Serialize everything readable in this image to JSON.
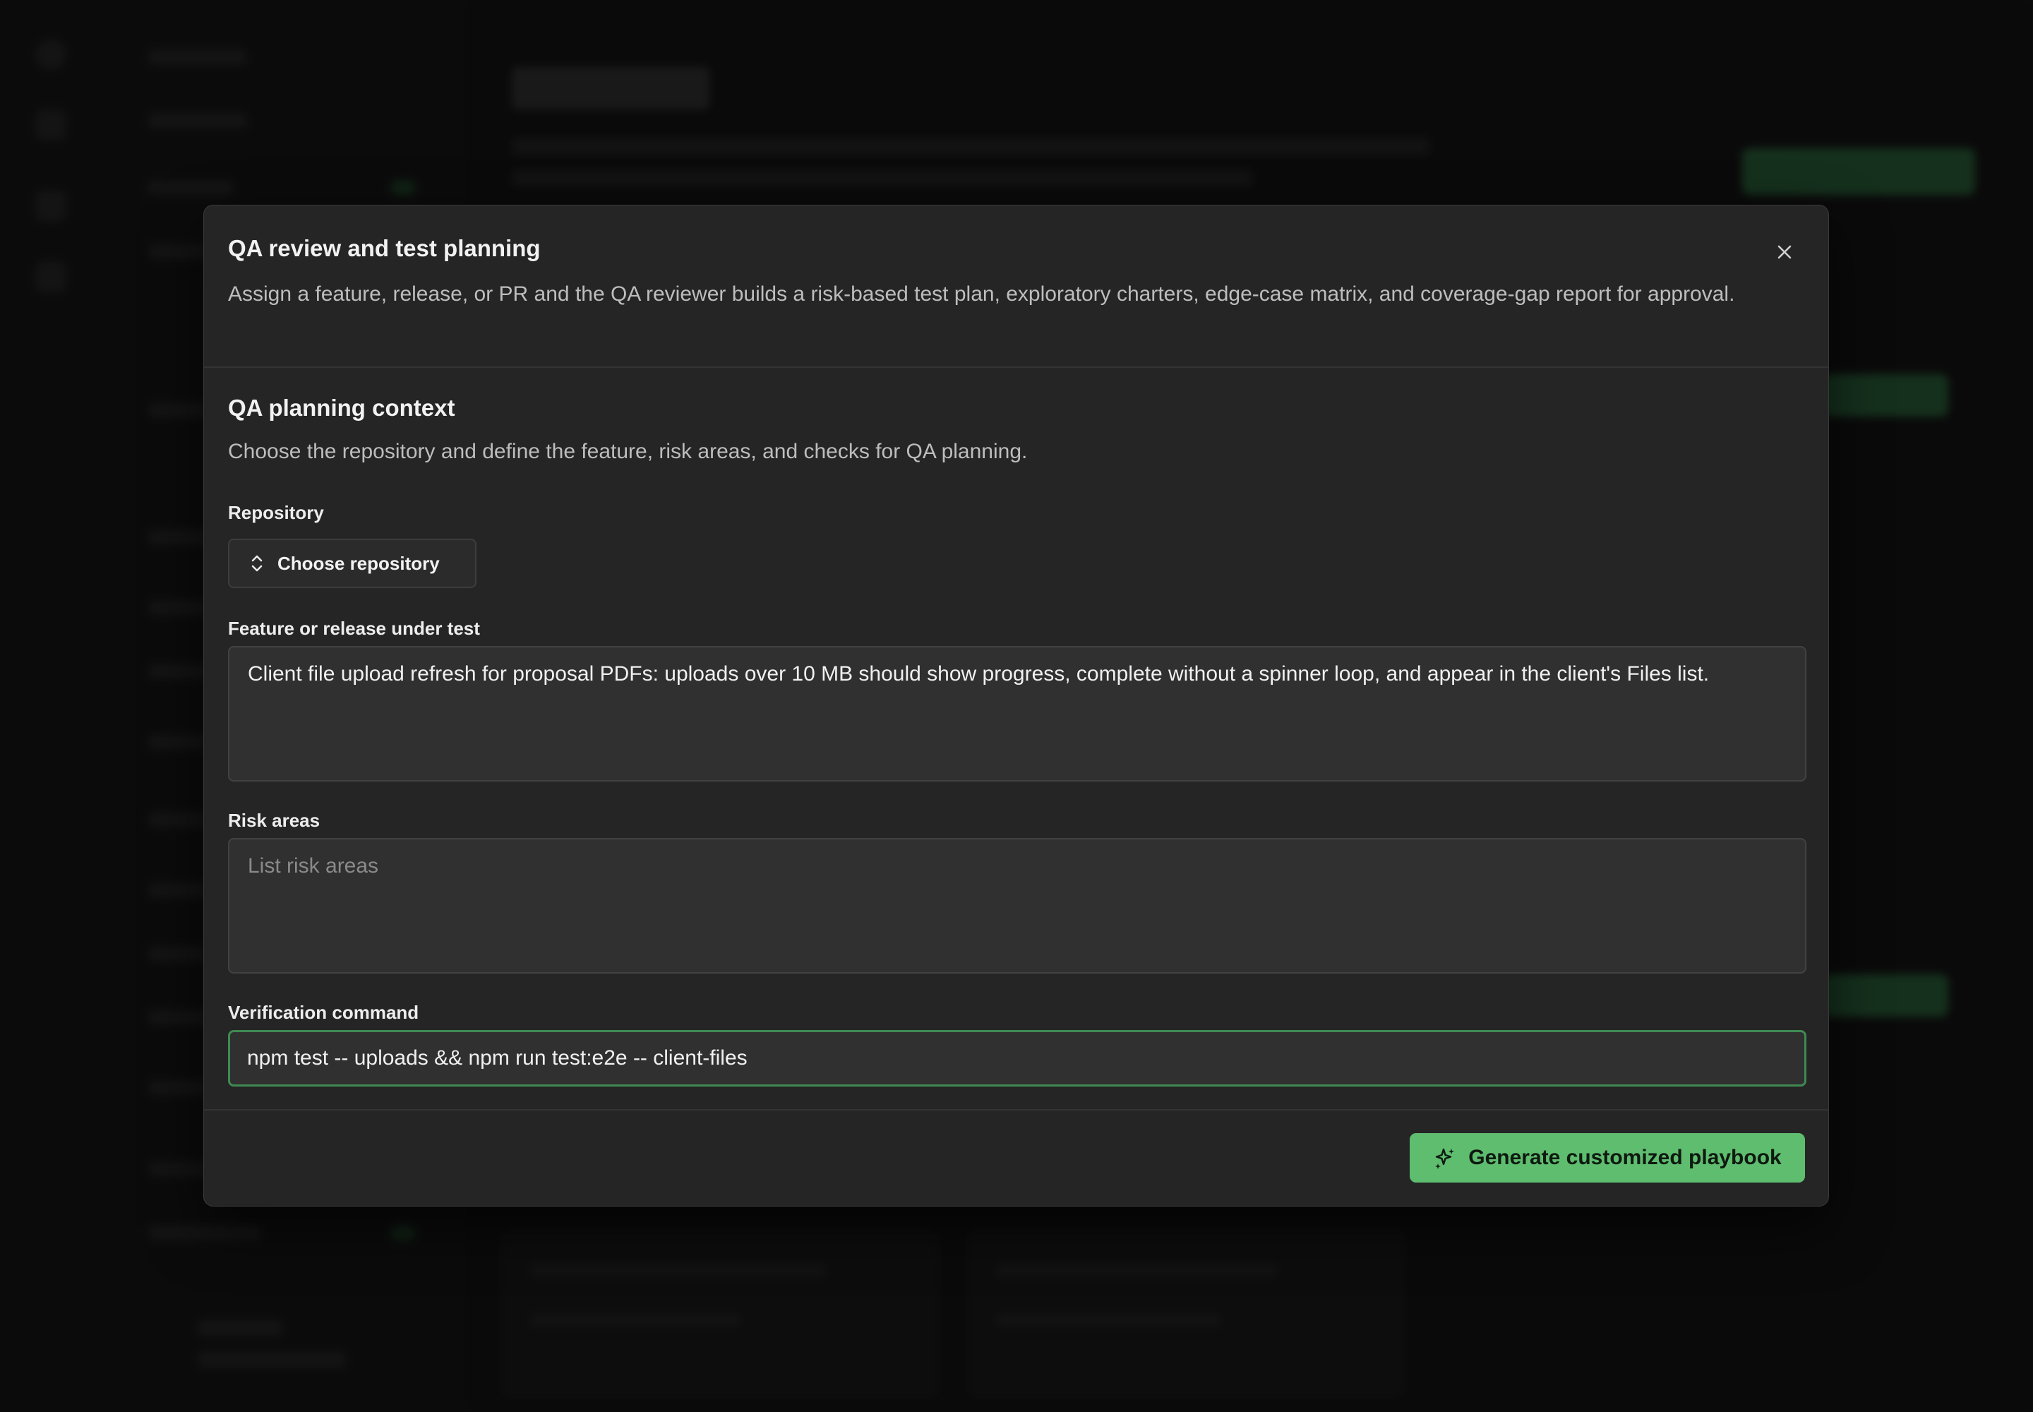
{
  "modal": {
    "title": "QA review and test planning",
    "description": "Assign a feature, release, or PR and the QA reviewer builds a risk-based test plan, exploratory charters, edge-case matrix, and coverage-gap report for approval.",
    "close_icon": "close-icon"
  },
  "context": {
    "title": "QA planning context",
    "description": "Choose the repository and define the feature, risk areas, and checks for QA planning."
  },
  "repository": {
    "label": "Repository",
    "button_label": "Choose repository",
    "icon": "chevron-up-down-icon"
  },
  "feature": {
    "label": "Feature or release under test",
    "value": "Client file upload refresh for proposal PDFs: uploads over 10 MB should show progress, complete without a spinner loop, and appear in the client's Files list."
  },
  "risk": {
    "label": "Risk areas",
    "placeholder": "List risk areas",
    "value": ""
  },
  "verification": {
    "label": "Verification command",
    "value": "npm test -- uploads && npm run test:e2e -- client-files"
  },
  "actions": {
    "generate_label": "Generate customized playbook",
    "generate_icon": "sparkles-icon"
  },
  "colors": {
    "accent": "#5fbd6f",
    "focus_border": "#3f8a52",
    "modal_bg": "#252525"
  }
}
